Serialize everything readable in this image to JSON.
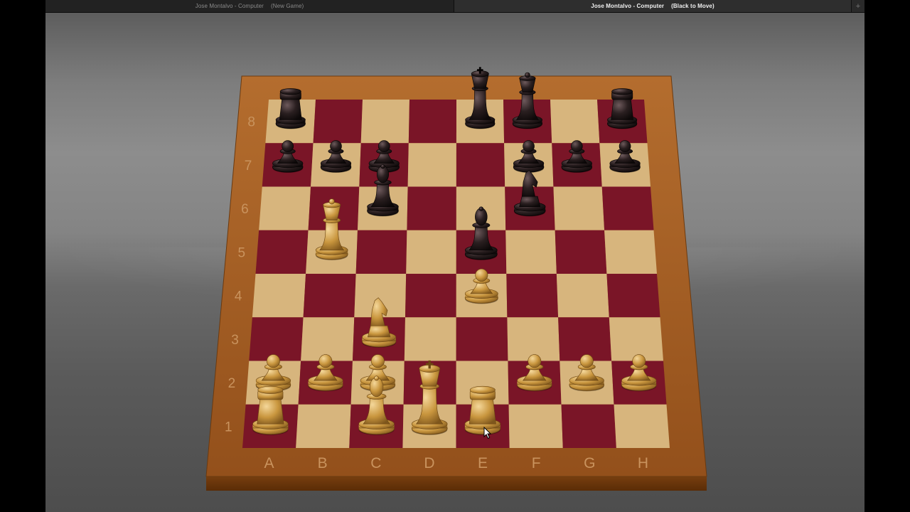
{
  "window": {
    "tabs": [
      {
        "title": "Jose Montalvo - Computer",
        "status": "(New Game)",
        "active": false
      },
      {
        "title": "Jose Montalvo - Computer",
        "status": "(Black to Move)",
        "active": true
      }
    ],
    "add_tab_label": "+"
  },
  "board": {
    "files": [
      "A",
      "B",
      "C",
      "D",
      "E",
      "F",
      "G",
      "H"
    ],
    "ranks": [
      "1",
      "2",
      "3",
      "4",
      "5",
      "6",
      "7",
      "8"
    ],
    "colors": {
      "dark_square": "#7a1527",
      "light_square": "#d7b57d",
      "frame": "#9b5a22"
    }
  },
  "pieces": {
    "white": [
      {
        "type": "rook",
        "square": "a1"
      },
      {
        "type": "bishop",
        "square": "c1"
      },
      {
        "type": "king",
        "square": "d1"
      },
      {
        "type": "rook",
        "square": "e1"
      },
      {
        "type": "pawn",
        "square": "a2"
      },
      {
        "type": "pawn",
        "square": "b2"
      },
      {
        "type": "pawn",
        "square": "c2"
      },
      {
        "type": "pawn",
        "square": "f2"
      },
      {
        "type": "pawn",
        "square": "g2"
      },
      {
        "type": "pawn",
        "square": "h2"
      },
      {
        "type": "knight",
        "square": "c3"
      },
      {
        "type": "pawn",
        "square": "e4"
      },
      {
        "type": "queen",
        "square": "b5"
      }
    ],
    "black": [
      {
        "type": "rook",
        "square": "a8"
      },
      {
        "type": "king",
        "square": "e8"
      },
      {
        "type": "queen",
        "square": "f8"
      },
      {
        "type": "rook",
        "square": "h8"
      },
      {
        "type": "pawn",
        "square": "a7"
      },
      {
        "type": "pawn",
        "square": "b7"
      },
      {
        "type": "pawn",
        "square": "c7"
      },
      {
        "type": "pawn",
        "square": "f7"
      },
      {
        "type": "pawn",
        "square": "g7"
      },
      {
        "type": "pawn",
        "square": "h7"
      },
      {
        "type": "bishop",
        "square": "c6"
      },
      {
        "type": "knight",
        "square": "f6"
      },
      {
        "type": "bishop",
        "square": "e5"
      }
    ]
  }
}
